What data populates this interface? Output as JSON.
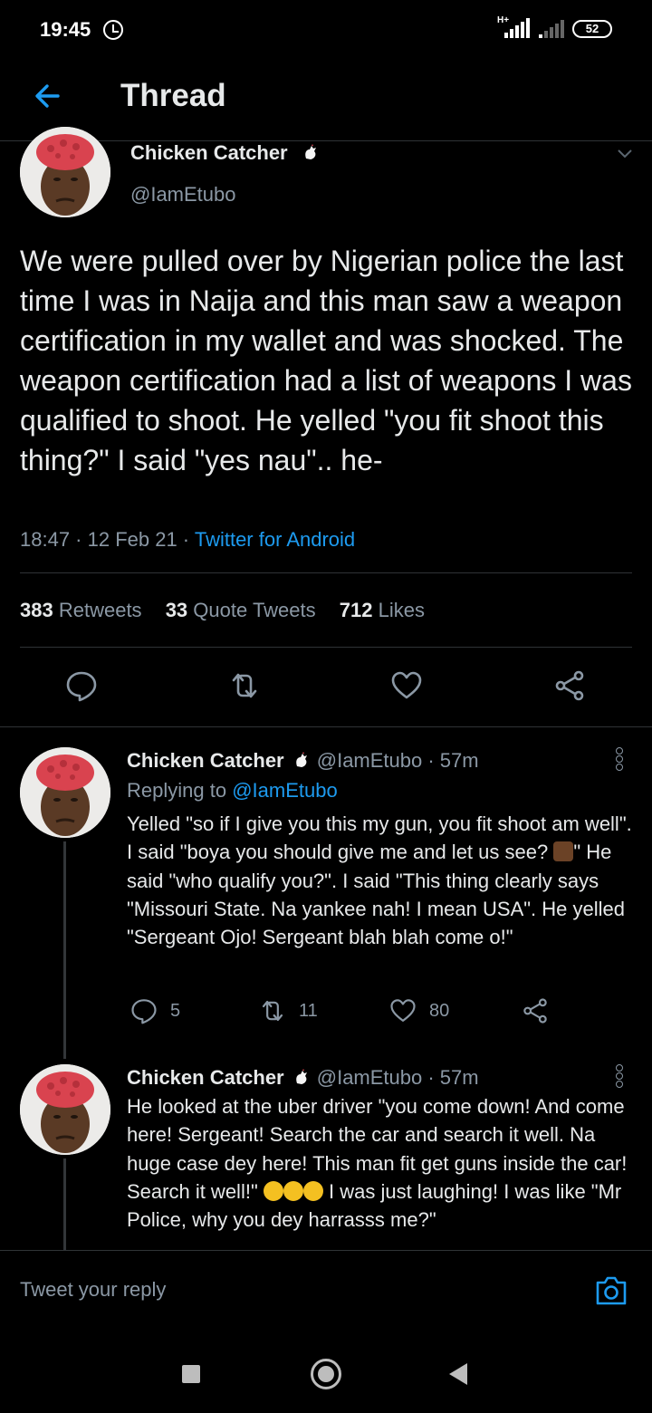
{
  "status_bar": {
    "time": "19:45",
    "network": "H+",
    "battery": "52"
  },
  "header": {
    "title": "Thread"
  },
  "main_tweet": {
    "author_name": "Chicken Catcher",
    "author_handle": "@IamEtubo",
    "text": "We were pulled over by Nigerian police the last time I was in Naija and this man saw a weapon certification in my wallet and was shocked. The weapon certification had a list of weapons I was  qualified to shoot. He yelled \"you fit shoot this thing?\" I said \"yes nau\".. he-",
    "timestamp": "18:47 · 12 Feb 21 · ",
    "source": "Twitter for Android",
    "stats": {
      "retweets_count": "383",
      "retweets_label": "Retweets",
      "quotes_count": "33",
      "quotes_label": "Quote Tweets",
      "likes_count": "712",
      "likes_label": "Likes"
    }
  },
  "replies": [
    {
      "author_name": "Chicken Catcher",
      "handle_time": "@IamEtubo · 57m",
      "replying_prefix": "Replying to ",
      "replying_to": "@IamEtubo",
      "text_part1": "Yelled \"so if I give you this my gun, you fit shoot am well\". I said \"boya you should give me and let us see? ",
      "text_part2": "\" He said \"who qualify you?\". I said \"This thing clearly says \"Missouri State. Na yankee nah! I mean USA\". He yelled \"Sergeant Ojo! Sergeant blah blah come o!\"",
      "reply_count": "5",
      "retweet_count": "11",
      "like_count": "80"
    },
    {
      "author_name": "Chicken Catcher",
      "handle_time": "@IamEtubo · 57m",
      "text_part1": "He looked at the uber driver \"you come down! And come here! Sergeant! Search the car and search it well. Na huge case dey here! This man fit get guns inside the car! Search it well!\" ",
      "text_part2": " I was just laughing! I was like \"Mr Police, why you dey harrasss me?\""
    }
  ],
  "composer": {
    "placeholder": "Tweet your reply"
  },
  "colors": {
    "background": "#000000",
    "text": "#e7e9ea",
    "secondary_text": "#8b98a5",
    "accent_blue": "#1d9bf0",
    "divider": "#2f3336"
  },
  "icons": [
    "alarm-icon",
    "signal-icon",
    "battery-icon",
    "back-arrow-icon",
    "rooster-badge-icon",
    "chevron-down-icon",
    "reply-icon",
    "retweet-icon",
    "like-icon",
    "share-icon",
    "more-icon",
    "camera-icon",
    "nav-recents-icon",
    "nav-home-icon",
    "nav-back-icon"
  ]
}
